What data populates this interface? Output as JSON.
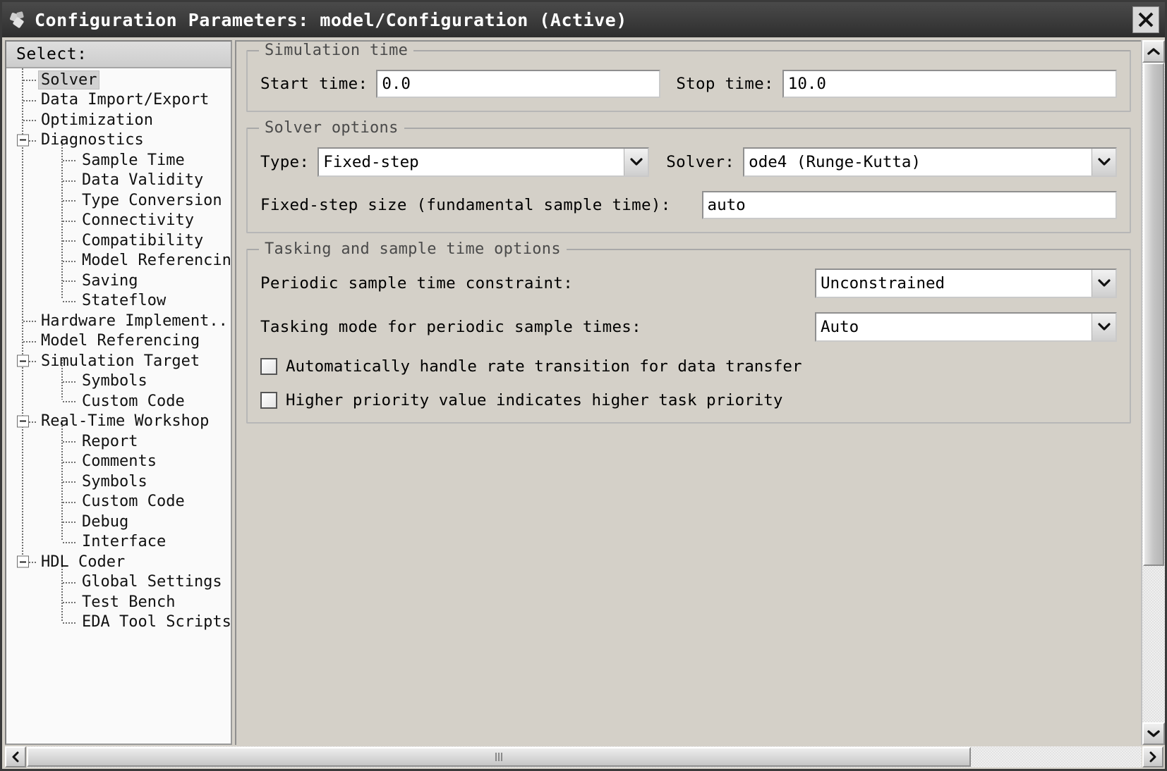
{
  "window": {
    "title": "Configuration Parameters: model/Configuration (Active)",
    "close_label": "✕"
  },
  "sidebar": {
    "header": "Select:",
    "items": [
      {
        "label": "Solver",
        "level": 0,
        "selected": true,
        "expander": false,
        "last": false
      },
      {
        "label": "Data Import/Export",
        "level": 0,
        "selected": false,
        "expander": false,
        "last": false
      },
      {
        "label": "Optimization",
        "level": 0,
        "selected": false,
        "expander": false,
        "last": false
      },
      {
        "label": "Diagnostics",
        "level": 0,
        "selected": false,
        "expander": true,
        "last": false
      },
      {
        "label": "Sample Time",
        "level": 1,
        "selected": false,
        "expander": false,
        "last": false
      },
      {
        "label": "Data Validity",
        "level": 1,
        "selected": false,
        "expander": false,
        "last": false
      },
      {
        "label": "Type Conversion",
        "level": 1,
        "selected": false,
        "expander": false,
        "last": false
      },
      {
        "label": "Connectivity",
        "level": 1,
        "selected": false,
        "expander": false,
        "last": false
      },
      {
        "label": "Compatibility",
        "level": 1,
        "selected": false,
        "expander": false,
        "last": false
      },
      {
        "label": "Model Referencing",
        "level": 1,
        "selected": false,
        "expander": false,
        "last": false
      },
      {
        "label": "Saving",
        "level": 1,
        "selected": false,
        "expander": false,
        "last": false
      },
      {
        "label": "Stateflow",
        "level": 1,
        "selected": false,
        "expander": false,
        "last": true
      },
      {
        "label": "Hardware Implement...",
        "level": 0,
        "selected": false,
        "expander": false,
        "last": false
      },
      {
        "label": "Model Referencing",
        "level": 0,
        "selected": false,
        "expander": false,
        "last": false
      },
      {
        "label": "Simulation Target",
        "level": 0,
        "selected": false,
        "expander": true,
        "last": false
      },
      {
        "label": "Symbols",
        "level": 1,
        "selected": false,
        "expander": false,
        "last": false
      },
      {
        "label": "Custom Code",
        "level": 1,
        "selected": false,
        "expander": false,
        "last": true
      },
      {
        "label": "Real-Time Workshop",
        "level": 0,
        "selected": false,
        "expander": true,
        "last": false
      },
      {
        "label": "Report",
        "level": 1,
        "selected": false,
        "expander": false,
        "last": false
      },
      {
        "label": "Comments",
        "level": 1,
        "selected": false,
        "expander": false,
        "last": false
      },
      {
        "label": "Symbols",
        "level": 1,
        "selected": false,
        "expander": false,
        "last": false
      },
      {
        "label": "Custom Code",
        "level": 1,
        "selected": false,
        "expander": false,
        "last": false
      },
      {
        "label": "Debug",
        "level": 1,
        "selected": false,
        "expander": false,
        "last": false
      },
      {
        "label": "Interface",
        "level": 1,
        "selected": false,
        "expander": false,
        "last": true
      },
      {
        "label": "HDL Coder",
        "level": 0,
        "selected": false,
        "expander": true,
        "last": true
      },
      {
        "label": "Global Settings",
        "level": 1,
        "selected": false,
        "expander": false,
        "last": false
      },
      {
        "label": "Test Bench",
        "level": 1,
        "selected": false,
        "expander": false,
        "last": false
      },
      {
        "label": "EDA Tool Scripts",
        "level": 1,
        "selected": false,
        "expander": false,
        "last": true
      }
    ]
  },
  "panel": {
    "simulation_time": {
      "legend": "Simulation time",
      "start_label": "Start time:",
      "start_value": "0.0",
      "stop_label": "Stop time:",
      "stop_value": "10.0"
    },
    "solver_options": {
      "legend": "Solver options",
      "type_label": "Type:",
      "type_value": "Fixed-step",
      "solver_label": "Solver:",
      "solver_value": "ode4 (Runge-Kutta)",
      "fixed_step_label": "Fixed-step size (fundamental sample time):",
      "fixed_step_value": "auto"
    },
    "tasking": {
      "legend": "Tasking and sample time options",
      "periodic_label": "Periodic sample time constraint:",
      "periodic_value": "Unconstrained",
      "mode_label": "Tasking mode for periodic sample times:",
      "mode_value": "Auto",
      "auto_rate_label": "Automatically handle rate transition for data transfer",
      "auto_rate_checked": false,
      "priority_label": "Higher priority value indicates higher task priority",
      "priority_checked": false
    }
  }
}
